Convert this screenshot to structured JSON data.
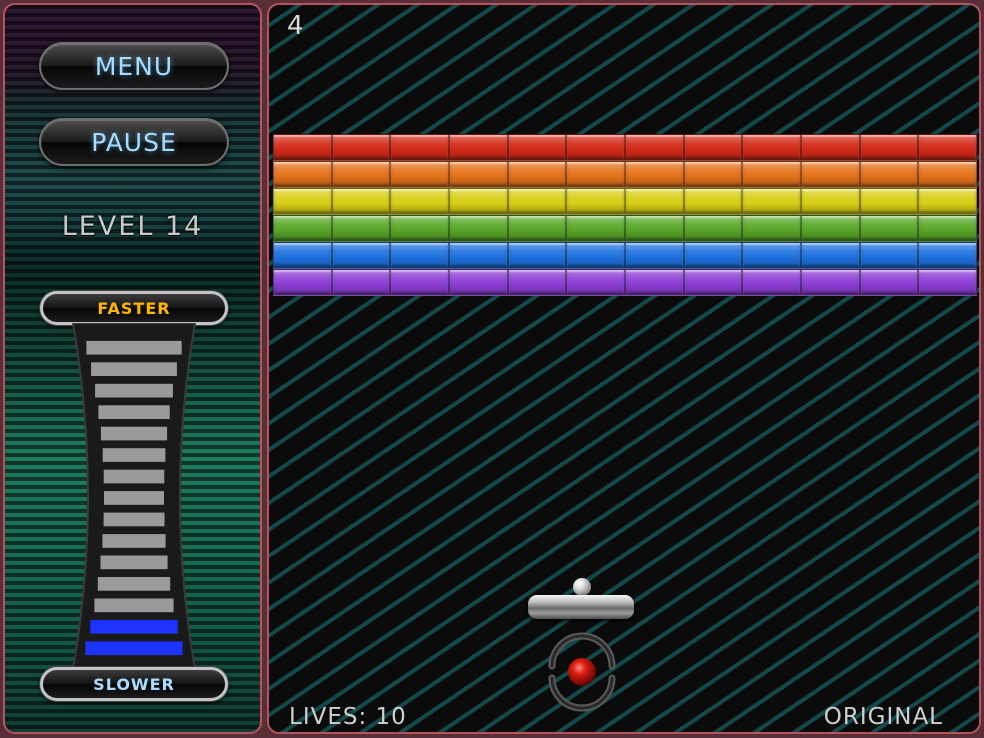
{
  "sidebar": {
    "menu_label": "MENU",
    "pause_label": "PAUSE",
    "level_text": "LEVEL 14",
    "speed": {
      "faster_label": "FASTER",
      "slower_label": "SLOWER",
      "total_segments": 15,
      "active_segments": 2,
      "active_color": "#1d34ff"
    }
  },
  "game": {
    "score": "4",
    "lives_text": "LIVES: 10",
    "mode_text": "ORIGINAL",
    "brick_columns": 12,
    "brick_rows": [
      {
        "name": "red",
        "color": "#d42b1a"
      },
      {
        "name": "orange",
        "color": "#e5731b"
      },
      {
        "name": "yellow",
        "color": "#d9cf18"
      },
      {
        "name": "green",
        "color": "#5aa82a"
      },
      {
        "name": "blue",
        "color": "#1f72e0"
      },
      {
        "name": "purple",
        "color": "#8e3fd6"
      }
    ]
  }
}
